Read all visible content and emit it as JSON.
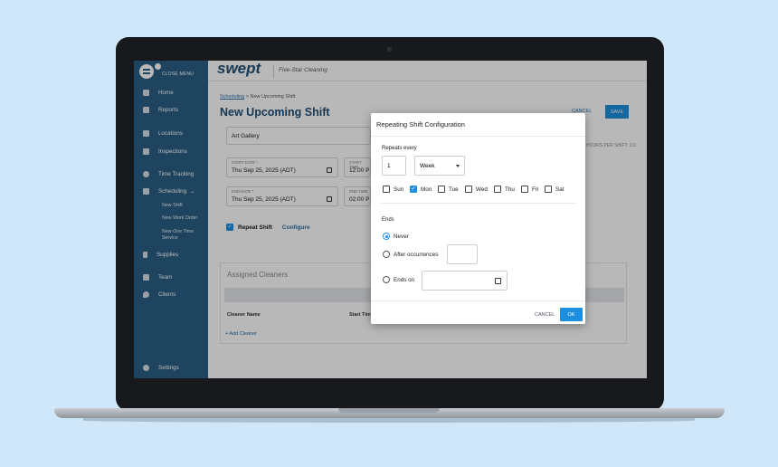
{
  "sidebar": {
    "close_menu": "CLOSE MENU",
    "items": [
      {
        "label": "Home",
        "icon": "dashboard-icon"
      },
      {
        "label": "Reports",
        "icon": "reports-icon"
      },
      {
        "label": "Locations",
        "icon": "building-icon"
      },
      {
        "label": "Inspections",
        "icon": "clipboard-icon"
      },
      {
        "label": "Time Tracking",
        "icon": "clock-icon"
      },
      {
        "label": "Scheduling",
        "icon": "calendar-icon"
      },
      {
        "label": "Supplies",
        "icon": "bottle-icon"
      },
      {
        "label": "Team",
        "icon": "team-icon"
      },
      {
        "label": "Clients",
        "icon": "location-pin-icon"
      },
      {
        "label": "Settings",
        "icon": "gear-icon"
      }
    ],
    "sub_items": [
      "New Shift",
      "New Work Order",
      "New One Time Service"
    ]
  },
  "header": {
    "logo": "swept",
    "tagline": "Five-Star Cleaning"
  },
  "breadcrumb": {
    "parent": "Scheduling",
    "separator": ">",
    "current": "New Upcoming Shift"
  },
  "page": {
    "title": "New Upcoming Shift",
    "cancel": "CANCEL",
    "save": "SAVE",
    "location_value": "Art Gallery",
    "start_date_label": "START DATE *",
    "start_date": "Thu Sep 25, 2025 (ADT)",
    "start_time_label": "START TIME",
    "start_time": "12:00 P",
    "end_date_label": "END DATE *",
    "end_date": "Thu Sep 25, 2025 (ADT)",
    "end_time_label": "END TIME",
    "end_time": "02:00 P",
    "repeat_shift": "Repeat Shift",
    "configure": "Configure",
    "side_note": "HOURS PER SHIFT: 2.0"
  },
  "cleaners": {
    "title": "Assigned Cleaners",
    "col_name": "Cleaner Name",
    "col_start": "Start Tim",
    "add": "+ Add Cleaner"
  },
  "modal": {
    "title": "Repeating Shift Configuration",
    "repeats_every_label": "Repeats every",
    "interval": "1",
    "unit": "Week",
    "days": [
      {
        "label": "Sun",
        "checked": false
      },
      {
        "label": "Mon",
        "checked": true
      },
      {
        "label": "Tue",
        "checked": false
      },
      {
        "label": "Wed",
        "checked": false
      },
      {
        "label": "Thu",
        "checked": false
      },
      {
        "label": "Fri",
        "checked": false
      },
      {
        "label": "Sat",
        "checked": false
      }
    ],
    "ends_label": "Ends",
    "never": "Never",
    "after_occurrences": "After occurrences",
    "ends_on": "Ends on",
    "selected_end": "Never",
    "cancel": "CANCEL",
    "ok": "OK"
  },
  "colors": {
    "sidebar": "#2a5f86",
    "accent": "#1c8fe0",
    "title": "#1f4f76",
    "background": "#cfe7f8"
  }
}
